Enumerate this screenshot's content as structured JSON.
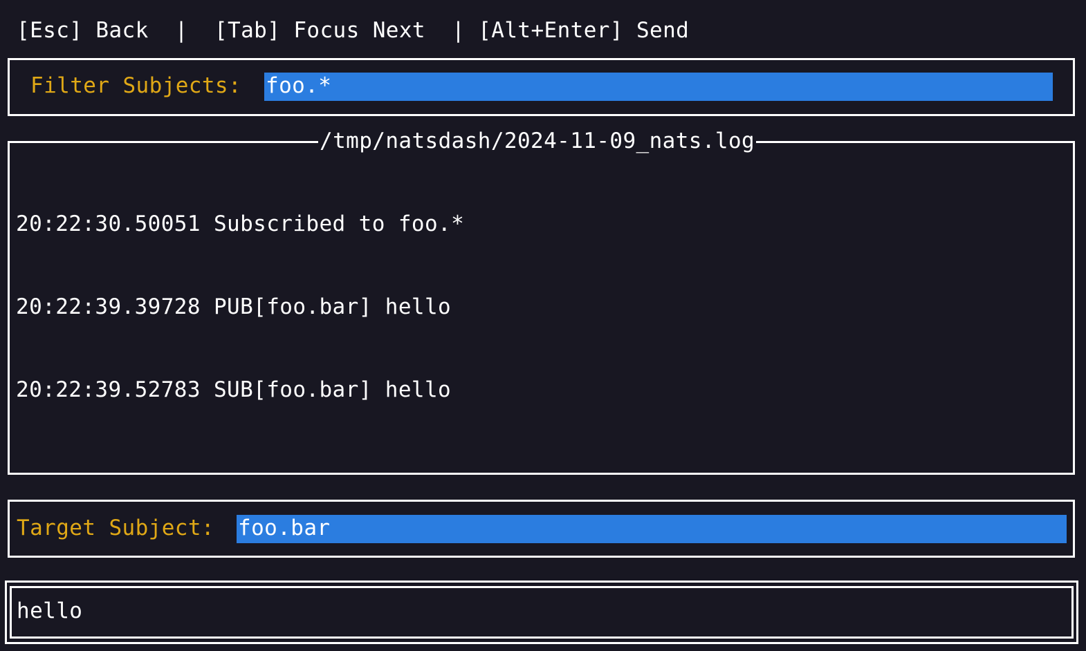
{
  "keybindings": [
    {
      "key": "[Esc]",
      "action": "Back"
    },
    {
      "key": "[Tab]",
      "action": "Focus Next"
    },
    {
      "key": "[Alt+Enter]",
      "action": "Send"
    }
  ],
  "hints_text": "[Esc] Back  |  [Tab] Focus Next  | [Alt+Enter] Send",
  "filter": {
    "label": "Filter Subjects:",
    "value": "foo.*"
  },
  "log": {
    "title": "/tmp/natsdash/2024-11-09_nats.log",
    "lines": [
      "20:22:30.50051 Subscribed to foo.*",
      "20:22:39.39728 PUB[foo.bar] hello",
      "20:22:39.52783 SUB[foo.bar] hello"
    ]
  },
  "target": {
    "label": "Target Subject:",
    "value": "foo.bar"
  },
  "message": {
    "value": "hello"
  },
  "colors": {
    "background": "#181722",
    "label": "#e0a816",
    "input_highlight": "#2b7de0",
    "border": "#ffffff"
  }
}
